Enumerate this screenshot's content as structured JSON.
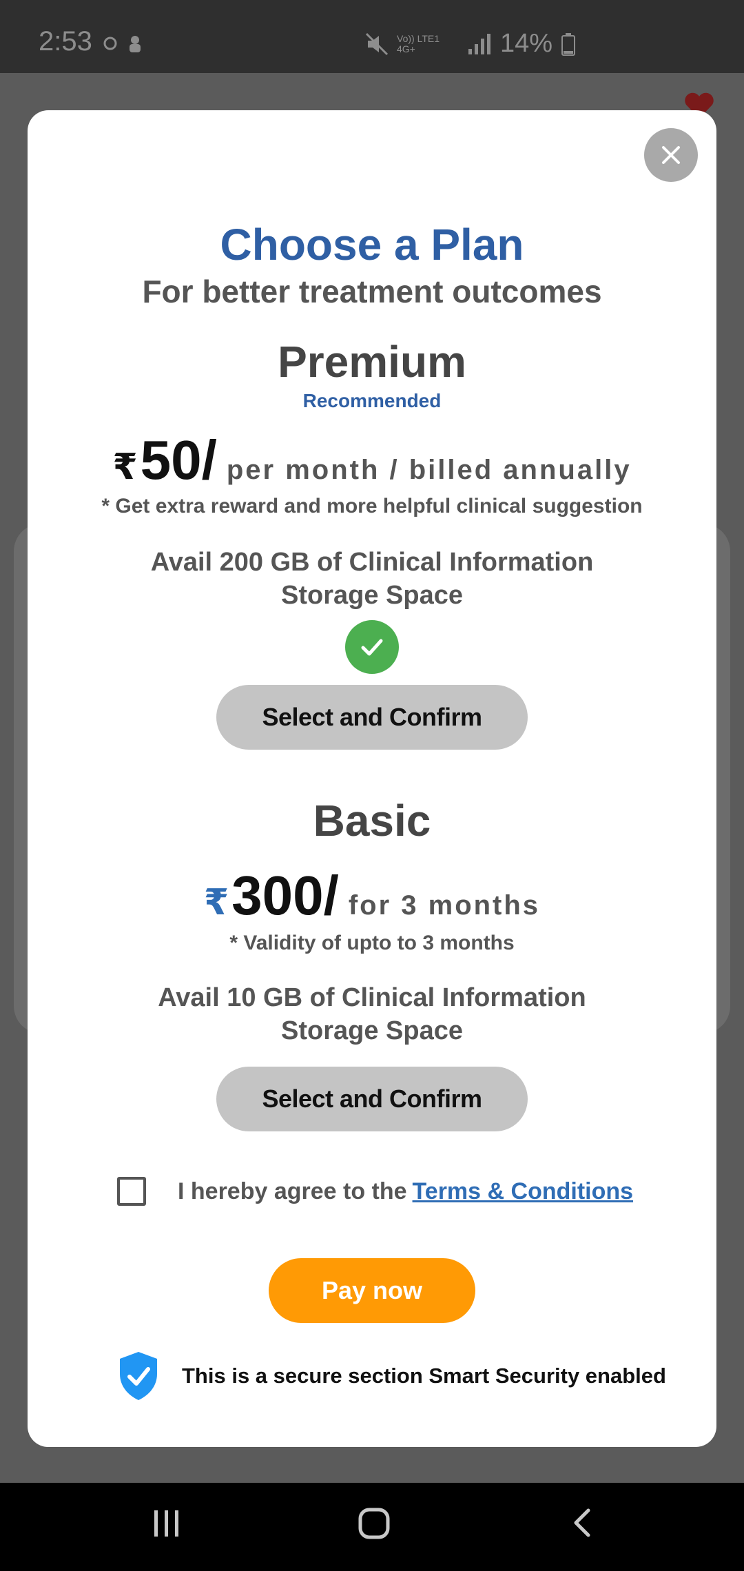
{
  "status_bar": {
    "time": "2:53",
    "network": "Vo)) LTE1 4G+",
    "battery": "14%"
  },
  "modal": {
    "title": "Choose a Plan",
    "subtitle": "For better treatment outcomes",
    "plans": [
      {
        "name": "Premium",
        "badge": "Recommended",
        "currency": "₹",
        "price": "50/",
        "period": "per month / billed annually",
        "note": "* Get extra reward and more helpful clinical suggestion",
        "storage_line1": "Avail 200 GB of Clinical Information",
        "storage_line2": "Storage Space",
        "selected": true,
        "button": "Select and Confirm"
      },
      {
        "name": "Basic",
        "currency": "₹",
        "price": "300/",
        "period": "for 3 months",
        "note": "* Validity of upto to 3 months",
        "storage_line1": "Avail 10 GB of Clinical Information",
        "storage_line2": "Storage Space",
        "selected": false,
        "button": "Select and Confirm"
      }
    ],
    "terms_text": "I hereby agree to the",
    "terms_link": " Terms & Conditions",
    "terms_checked": false,
    "pay_button": "Pay now",
    "secure_text": "This is a secure section Smart Security enabled"
  },
  "colors": {
    "accent_blue": "#2f5fa4",
    "pay_orange": "#ff9a05",
    "check_green": "#4caf50",
    "shield_blue": "#2196f3"
  },
  "icons": [
    "close-icon",
    "check-icon",
    "shield-check-icon",
    "recents-icon",
    "home-icon",
    "back-icon"
  ]
}
